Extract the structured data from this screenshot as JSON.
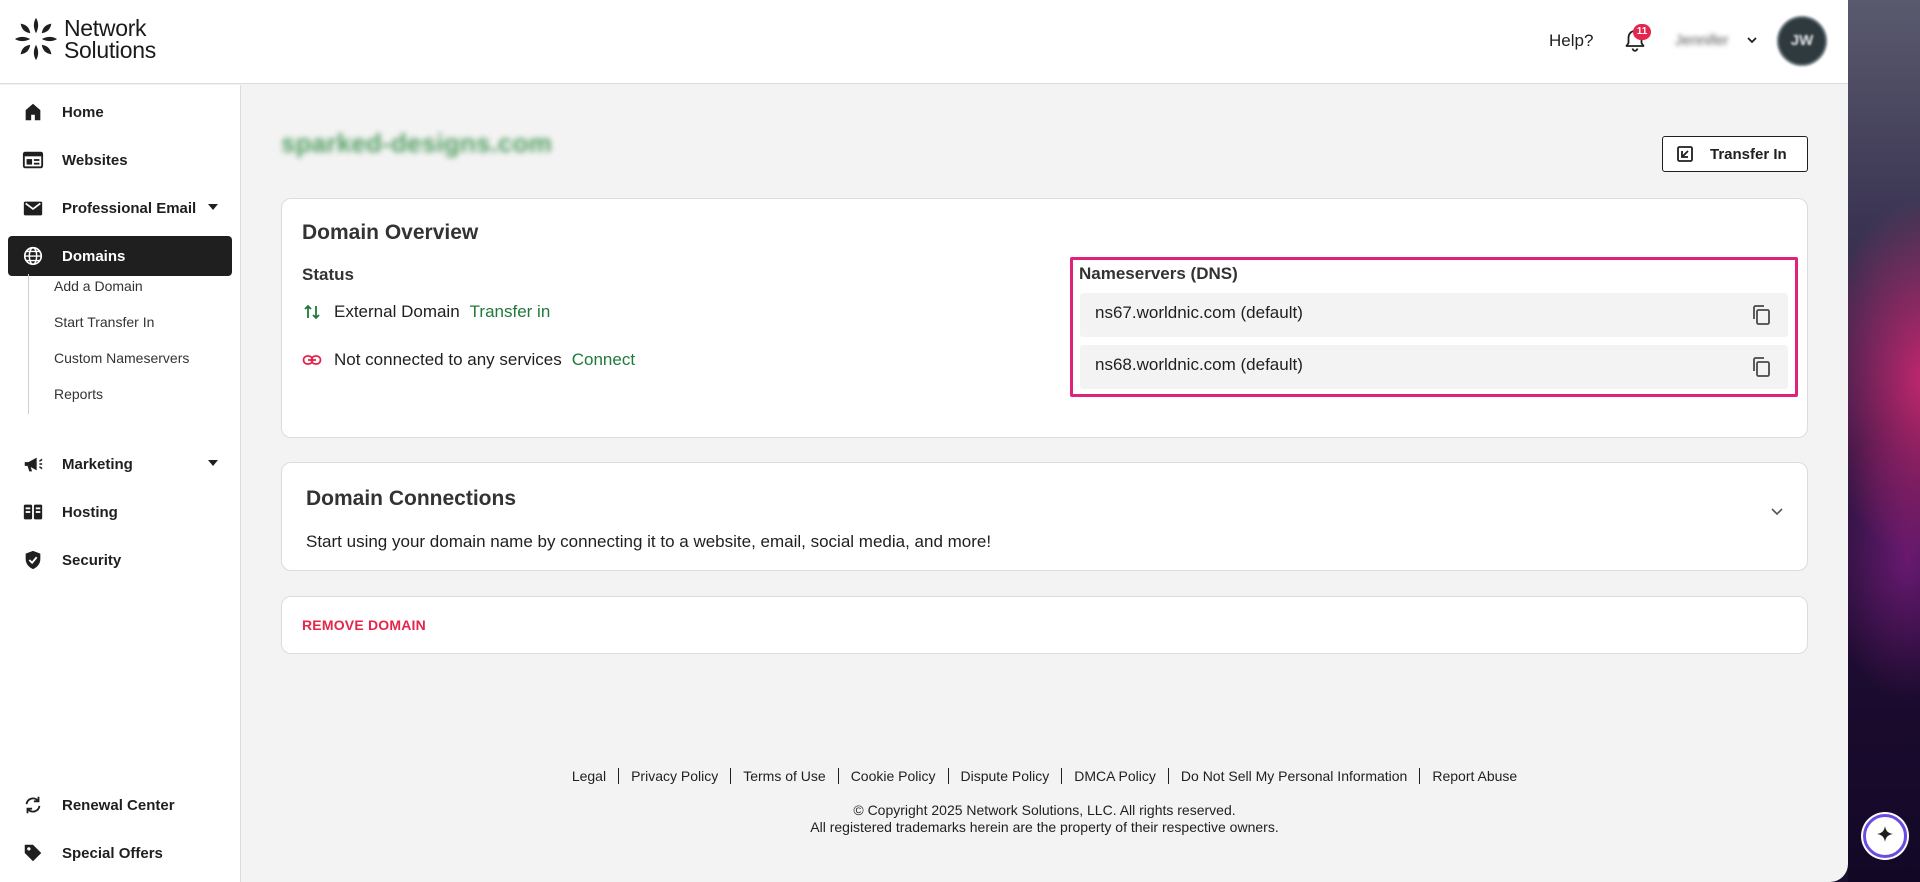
{
  "brand": {
    "line1": "Network",
    "line2": "Solutions"
  },
  "header": {
    "help_label": "Help?",
    "notification_count": "11",
    "user_name": "Jennifer",
    "avatar_initials": "JW"
  },
  "sidebar": {
    "items": [
      {
        "label": "Home",
        "icon": "home-icon"
      },
      {
        "label": "Websites",
        "icon": "website-icon"
      },
      {
        "label": "Professional Email",
        "icon": "mail-icon"
      },
      {
        "label": "Domains",
        "icon": "globe-icon"
      },
      {
        "label": "Marketing",
        "icon": "megaphone-icon"
      },
      {
        "label": "Hosting",
        "icon": "server-icon"
      },
      {
        "label": "Security",
        "icon": "shield-icon"
      }
    ],
    "domains_sub": [
      "Add a Domain",
      "Start Transfer In",
      "Custom Nameservers",
      "Reports"
    ],
    "bottom_items": [
      {
        "label": "Renewal Center",
        "icon": "renew-icon"
      },
      {
        "label": "Special Offers",
        "icon": "tag-icon"
      }
    ]
  },
  "main": {
    "domain_name": "sparked-designs.com",
    "transfer_button": "Transfer In",
    "overview": {
      "title": "Domain Overview",
      "status_label": "Status",
      "external_text": "External Domain",
      "external_link": "Transfer in",
      "connected_text": "Not connected to any services",
      "connected_link": "Connect",
      "nameservers_title": "Nameservers (DNS)",
      "nameservers": [
        "ns67.worldnic.com (default)",
        "ns68.worldnic.com (default)"
      ]
    },
    "connections": {
      "title": "Domain Connections",
      "description": "Start using your domain name by connecting it to a website, email, social media, and more!"
    },
    "remove_label": "REMOVE DOMAIN"
  },
  "footer": {
    "links": [
      "Legal",
      "Privacy Policy",
      "Terms of Use",
      "Cookie Policy",
      "Dispute Policy",
      "DMCA Policy",
      "Do Not Sell My Personal Information",
      "Report Abuse"
    ],
    "copyright": "© Copyright 2025 Network Solutions, LLC. All rights reserved.",
    "trademarks": "All registered trademarks herein are the property of their respective owners."
  },
  "colors": {
    "accent_green": "#1f7a3a",
    "highlight": "#e0237a",
    "danger": "#e5254b",
    "nav_active": "#1f1f1f"
  }
}
